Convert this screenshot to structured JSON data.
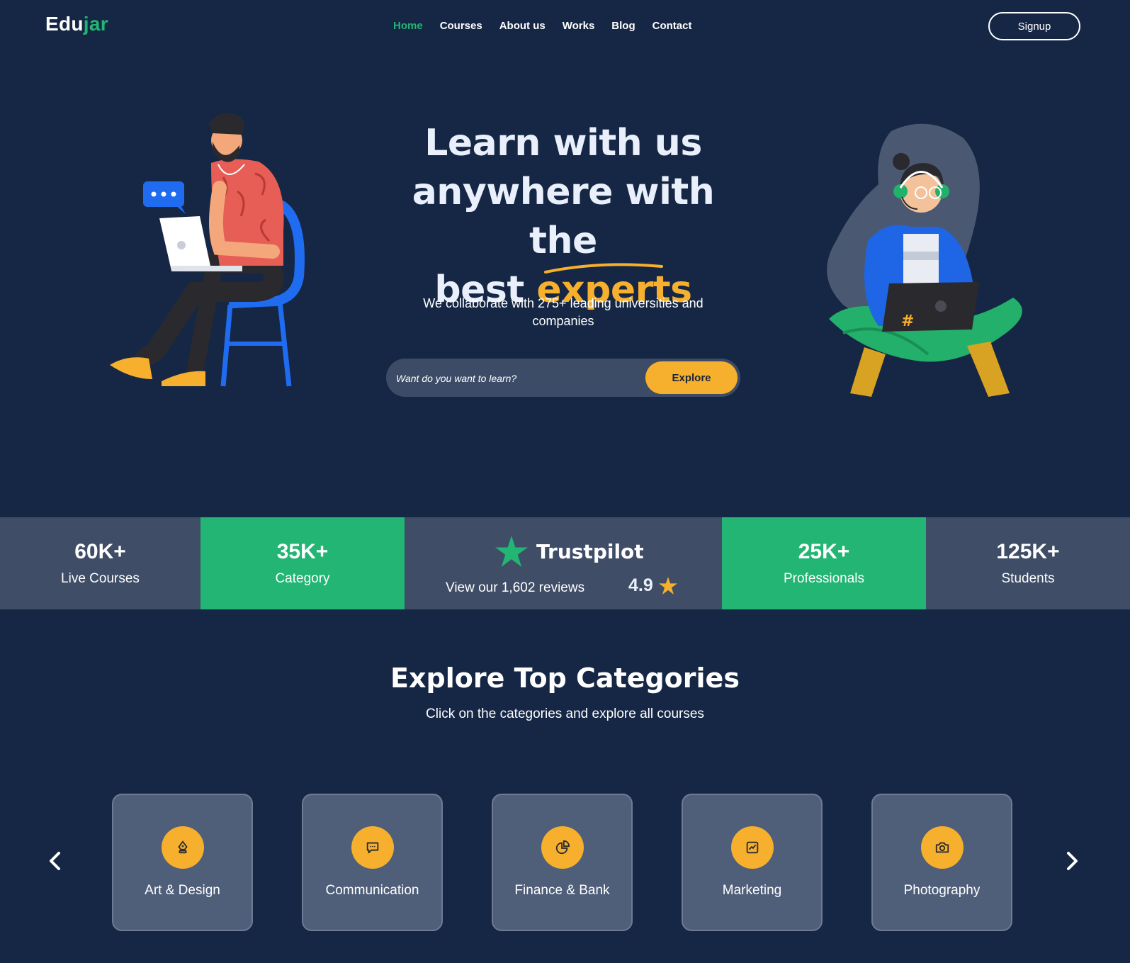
{
  "nav": {
    "logo_main": "Edu",
    "logo_accent": "jar",
    "links": [
      "Home",
      "Courses",
      "About us",
      "Works",
      "Blog",
      "Contact"
    ],
    "signup_label": "Signup",
    "accent_color": "#24b574"
  },
  "hero": {
    "title_line1": "Learn with us",
    "title_line2": "anywhere with the",
    "title_line3_plain": "best",
    "title_line3_highlight": "experts",
    "subtitle": "We collaborate with 275+ leading universities and companies",
    "search_placeholder": "Want do you want to learn?",
    "explore_label": "Explore",
    "highlight_color": "#f6b02e"
  },
  "stats": [
    {
      "value": "60K+",
      "label": "Live Courses"
    },
    {
      "value": "35K+",
      "label": "Category"
    },
    {
      "value": "25K+",
      "label": "Professionals"
    },
    {
      "value": "125K+",
      "label": "Students"
    }
  ],
  "trustpilot": {
    "name": "Trustpilot",
    "reviews": "View our 1,602 reviews",
    "rating": "4.9"
  },
  "categories": {
    "title": "Explore Top Categories",
    "subtitle": "Click on the categories and explore all courses",
    "items": [
      {
        "label": "Art & Design",
        "icon": "pen-tool-icon"
      },
      {
        "label": "Communication",
        "icon": "chat-icon"
      },
      {
        "label": "Finance & Bank",
        "icon": "pie-chart-icon"
      },
      {
        "label": "Marketing",
        "icon": "chart-icon"
      },
      {
        "label": "Photography",
        "icon": "camera-icon"
      }
    ]
  },
  "colors": {
    "background": "#152744",
    "green": "#22b573",
    "gray": "#3f4d67",
    "yellow": "#f6b02e"
  }
}
